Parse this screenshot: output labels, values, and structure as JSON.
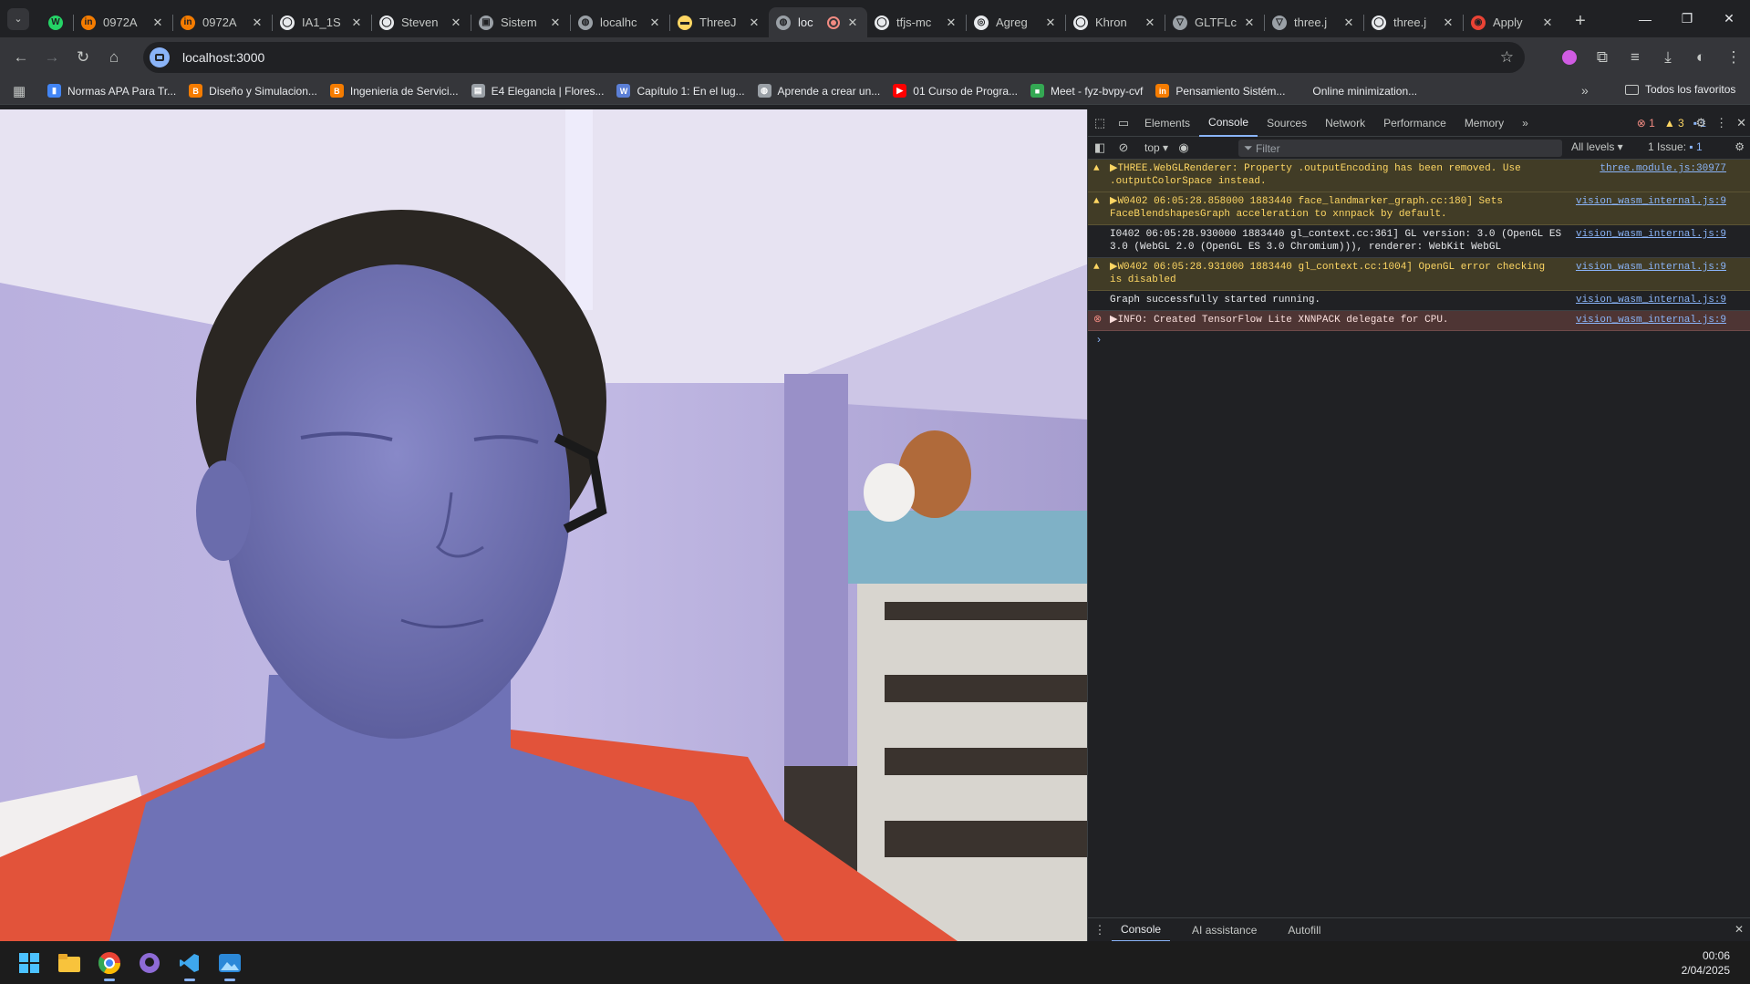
{
  "window": {
    "minimize": "—",
    "maximize": "❐",
    "close": "✕"
  },
  "tabs": [
    {
      "title": "",
      "color": "#25d366",
      "glyph": "W"
    },
    {
      "title": "0972A",
      "color": "#f57c00",
      "glyph": "in"
    },
    {
      "title": "0972A",
      "color": "#f57c00",
      "glyph": "in"
    },
    {
      "title": "IA1_1S",
      "color": "#e8eaed",
      "glyph": "◯"
    },
    {
      "title": "Steven",
      "color": "#e8eaed",
      "glyph": "◯"
    },
    {
      "title": "Sistem",
      "color": "#9aa0a6",
      "glyph": "▣"
    },
    {
      "title": "localhc",
      "color": "#9aa0a6",
      "glyph": "◍"
    },
    {
      "title": "ThreeJ",
      "color": "#fdd663",
      "glyph": "▬"
    },
    {
      "title": "loc",
      "color": "#9aa0a6",
      "glyph": "◍",
      "active": true
    },
    {
      "title": "tfjs-mc",
      "color": "#e8eaed",
      "glyph": "◯"
    },
    {
      "title": "Agreg",
      "color": "#e8eaed",
      "glyph": "◎"
    },
    {
      "title": "Khron",
      "color": "#e8eaed",
      "glyph": "◯"
    },
    {
      "title": "GLTFLc",
      "color": "#9aa0a6",
      "glyph": "▽"
    },
    {
      "title": "three.j",
      "color": "#9aa0a6",
      "glyph": "▽"
    },
    {
      "title": "three.j",
      "color": "#e8eaed",
      "glyph": "◯"
    },
    {
      "title": "Apply",
      "color": "#ea4335",
      "glyph": "◉"
    }
  ],
  "address": {
    "url": "localhost:3000"
  },
  "bookmarks": [
    {
      "label": "Normas APA Para Tr...",
      "color": "#4285f4",
      "glyph": "▮"
    },
    {
      "label": "Diseño y Simulacion...",
      "color": "#f57c00",
      "glyph": "B"
    },
    {
      "label": "Ingenieria de Servici...",
      "color": "#f57c00",
      "glyph": "B"
    },
    {
      "label": "E4 Elegancia | Flores...",
      "color": "#9aa0a6",
      "glyph": "▤"
    },
    {
      "label": "Capítulo 1: En el lug...",
      "color": "#5b7fd6",
      "glyph": "W"
    },
    {
      "label": "Aprende a crear un...",
      "color": "#9aa0a6",
      "glyph": "◍"
    },
    {
      "label": "01 Curso de Progra...",
      "color": "#ff0000",
      "glyph": "▶"
    },
    {
      "label": "Meet - fyz-bvpy-cvf",
      "color": "#34a853",
      "glyph": "■"
    },
    {
      "label": "Pensamiento Sistém...",
      "color": "#f57c00",
      "glyph": "in"
    },
    {
      "label": "Online minimization...",
      "color": "",
      "glyph": ""
    }
  ],
  "bookmarks_more": "»",
  "bookmarks_folder": "Todos los favoritos",
  "devtools": {
    "tabs": [
      "Elements",
      "Console",
      "Sources",
      "Network",
      "Performance",
      "Memory"
    ],
    "active_tab": "Console",
    "more": "»",
    "counts": {
      "errors": "1",
      "warnings": "3",
      "info": "1"
    },
    "context": "top ▾",
    "filter_placeholder": "Filter",
    "levels": "All levels ▾",
    "issues_label": "1 Issue:",
    "issues_count": "1",
    "messages": [
      {
        "level": "warn",
        "text": "▶THREE.WebGLRenderer: Property .outputEncoding has been removed. Use\n.outputColorSpace instead.",
        "source": "three.module.js:30977"
      },
      {
        "level": "warn",
        "text": "▶W0402 06:05:28.858000 1883440 face_landmarker_graph.cc:180] Sets\nFaceBlendshapesGraph acceleration to xnnpack by default.",
        "source": "vision_wasm_internal.js:9"
      },
      {
        "level": "log",
        "text": "I0402 06:05:28.930000 1883440 gl_context.cc:361] GL version: 3.0 (OpenGL ES\n3.0 (WebGL 2.0 (OpenGL ES 3.0 Chromium))), renderer: WebKit WebGL",
        "source": "vision_wasm_internal.js:9"
      },
      {
        "level": "warn",
        "text": "▶W0402 06:05:28.931000 1883440 gl_context.cc:1004] OpenGL error checking\nis disabled",
        "source": "vision_wasm_internal.js:9"
      },
      {
        "level": "log",
        "text": "Graph successfully started running.",
        "source": "vision_wasm_internal.js:9"
      },
      {
        "level": "err",
        "text": "▶INFO: Created TensorFlow Lite XNNPACK delegate for CPU.",
        "source": "vision_wasm_internal.js:9"
      }
    ],
    "prompt": "›",
    "drawer_tabs": [
      "Console",
      "AI assistance",
      "Autofill"
    ]
  },
  "taskbar": {
    "time": "00:06",
    "date": "2/04/2025"
  }
}
